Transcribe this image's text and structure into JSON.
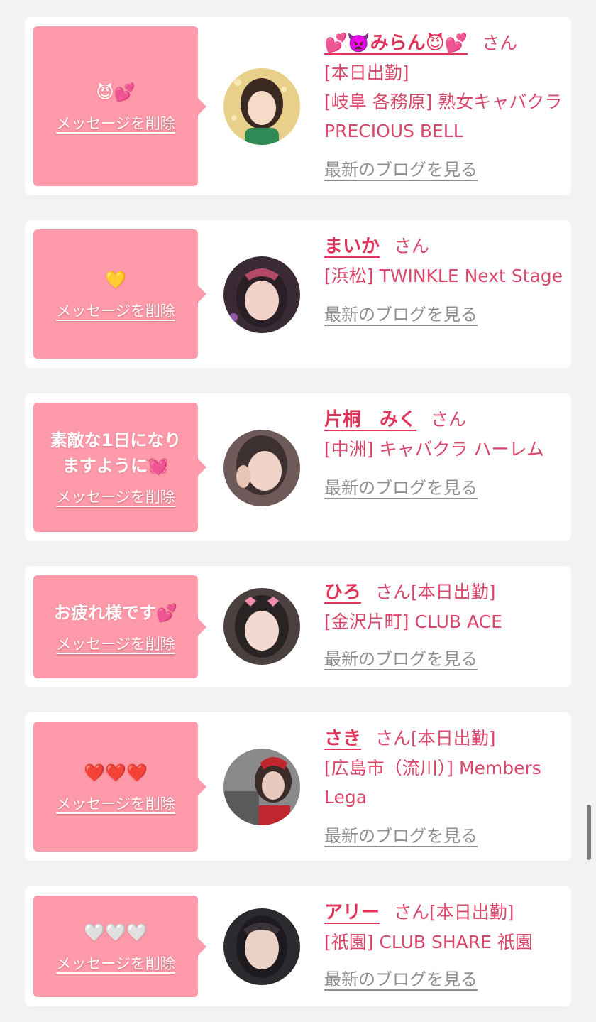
{
  "cards": [
    {
      "message": "😈💕",
      "delete_label": "メッセージを削除",
      "name": "💕👿みらん😈💕",
      "honorific": "さん",
      "status": "[本日出勤]",
      "shop": "[岐阜 各務原] 熟女キャバクラ PRECIOUS BELL",
      "blog_label": "最新のブログを見る",
      "avatar_colors": [
        "#e8d08a",
        "#3b2a22",
        "#2f8a55"
      ]
    },
    {
      "message": "💛",
      "delete_label": "メッセージを削除",
      "name": "まいか",
      "honorific": "さん",
      "status": "",
      "shop": "[浜松] TWINKLE Next Stage",
      "blog_label": "最新のブログを見る",
      "avatar_colors": [
        "#3a2a33",
        "#f1d2c8",
        "#b44a6a"
      ]
    },
    {
      "message": "素敵な1日になりますように💓",
      "delete_label": "メッセージを削除",
      "name": "片桐　みく",
      "honorific": "さん",
      "status": "",
      "shop": "[中洲] キャバクラ ハーレム",
      "blog_label": "最新のブログを見る",
      "avatar_colors": [
        "#6e5a58",
        "#f0d4c8",
        "#3d3231"
      ]
    },
    {
      "message": "お疲れ様です💕",
      "delete_label": "メッセージを削除",
      "name": "ひろ",
      "honorific": "さん",
      "status": "[本日出勤]",
      "shop": "[金沢片町] CLUB ACE",
      "blog_label": "最新のブログを見る",
      "avatar_colors": [
        "#4b4040",
        "#f3d9d0",
        "#2a2324"
      ]
    },
    {
      "message": "❤️❤️❤️",
      "delete_label": "メッセージを削除",
      "name": "さき",
      "honorific": "さん",
      "status": "[本日出勤]",
      "shop": "[広島市（流川）] Members Lega",
      "blog_label": "最新のブログを見る",
      "avatar_colors": [
        "#8a8a8a",
        "#e9c9bd",
        "#c0262e"
      ]
    },
    {
      "message": "🤍🤍🤍",
      "delete_label": "メッセージを削除",
      "name": "アリー",
      "honorific": "さん",
      "status": "[本日出勤]",
      "shop": "[祇園] CLUB SHARE 祇園",
      "blog_label": "最新のブログを見る",
      "avatar_colors": [
        "#2c2a2e",
        "#ecd2c6",
        "#1d1b1f"
      ]
    }
  ]
}
